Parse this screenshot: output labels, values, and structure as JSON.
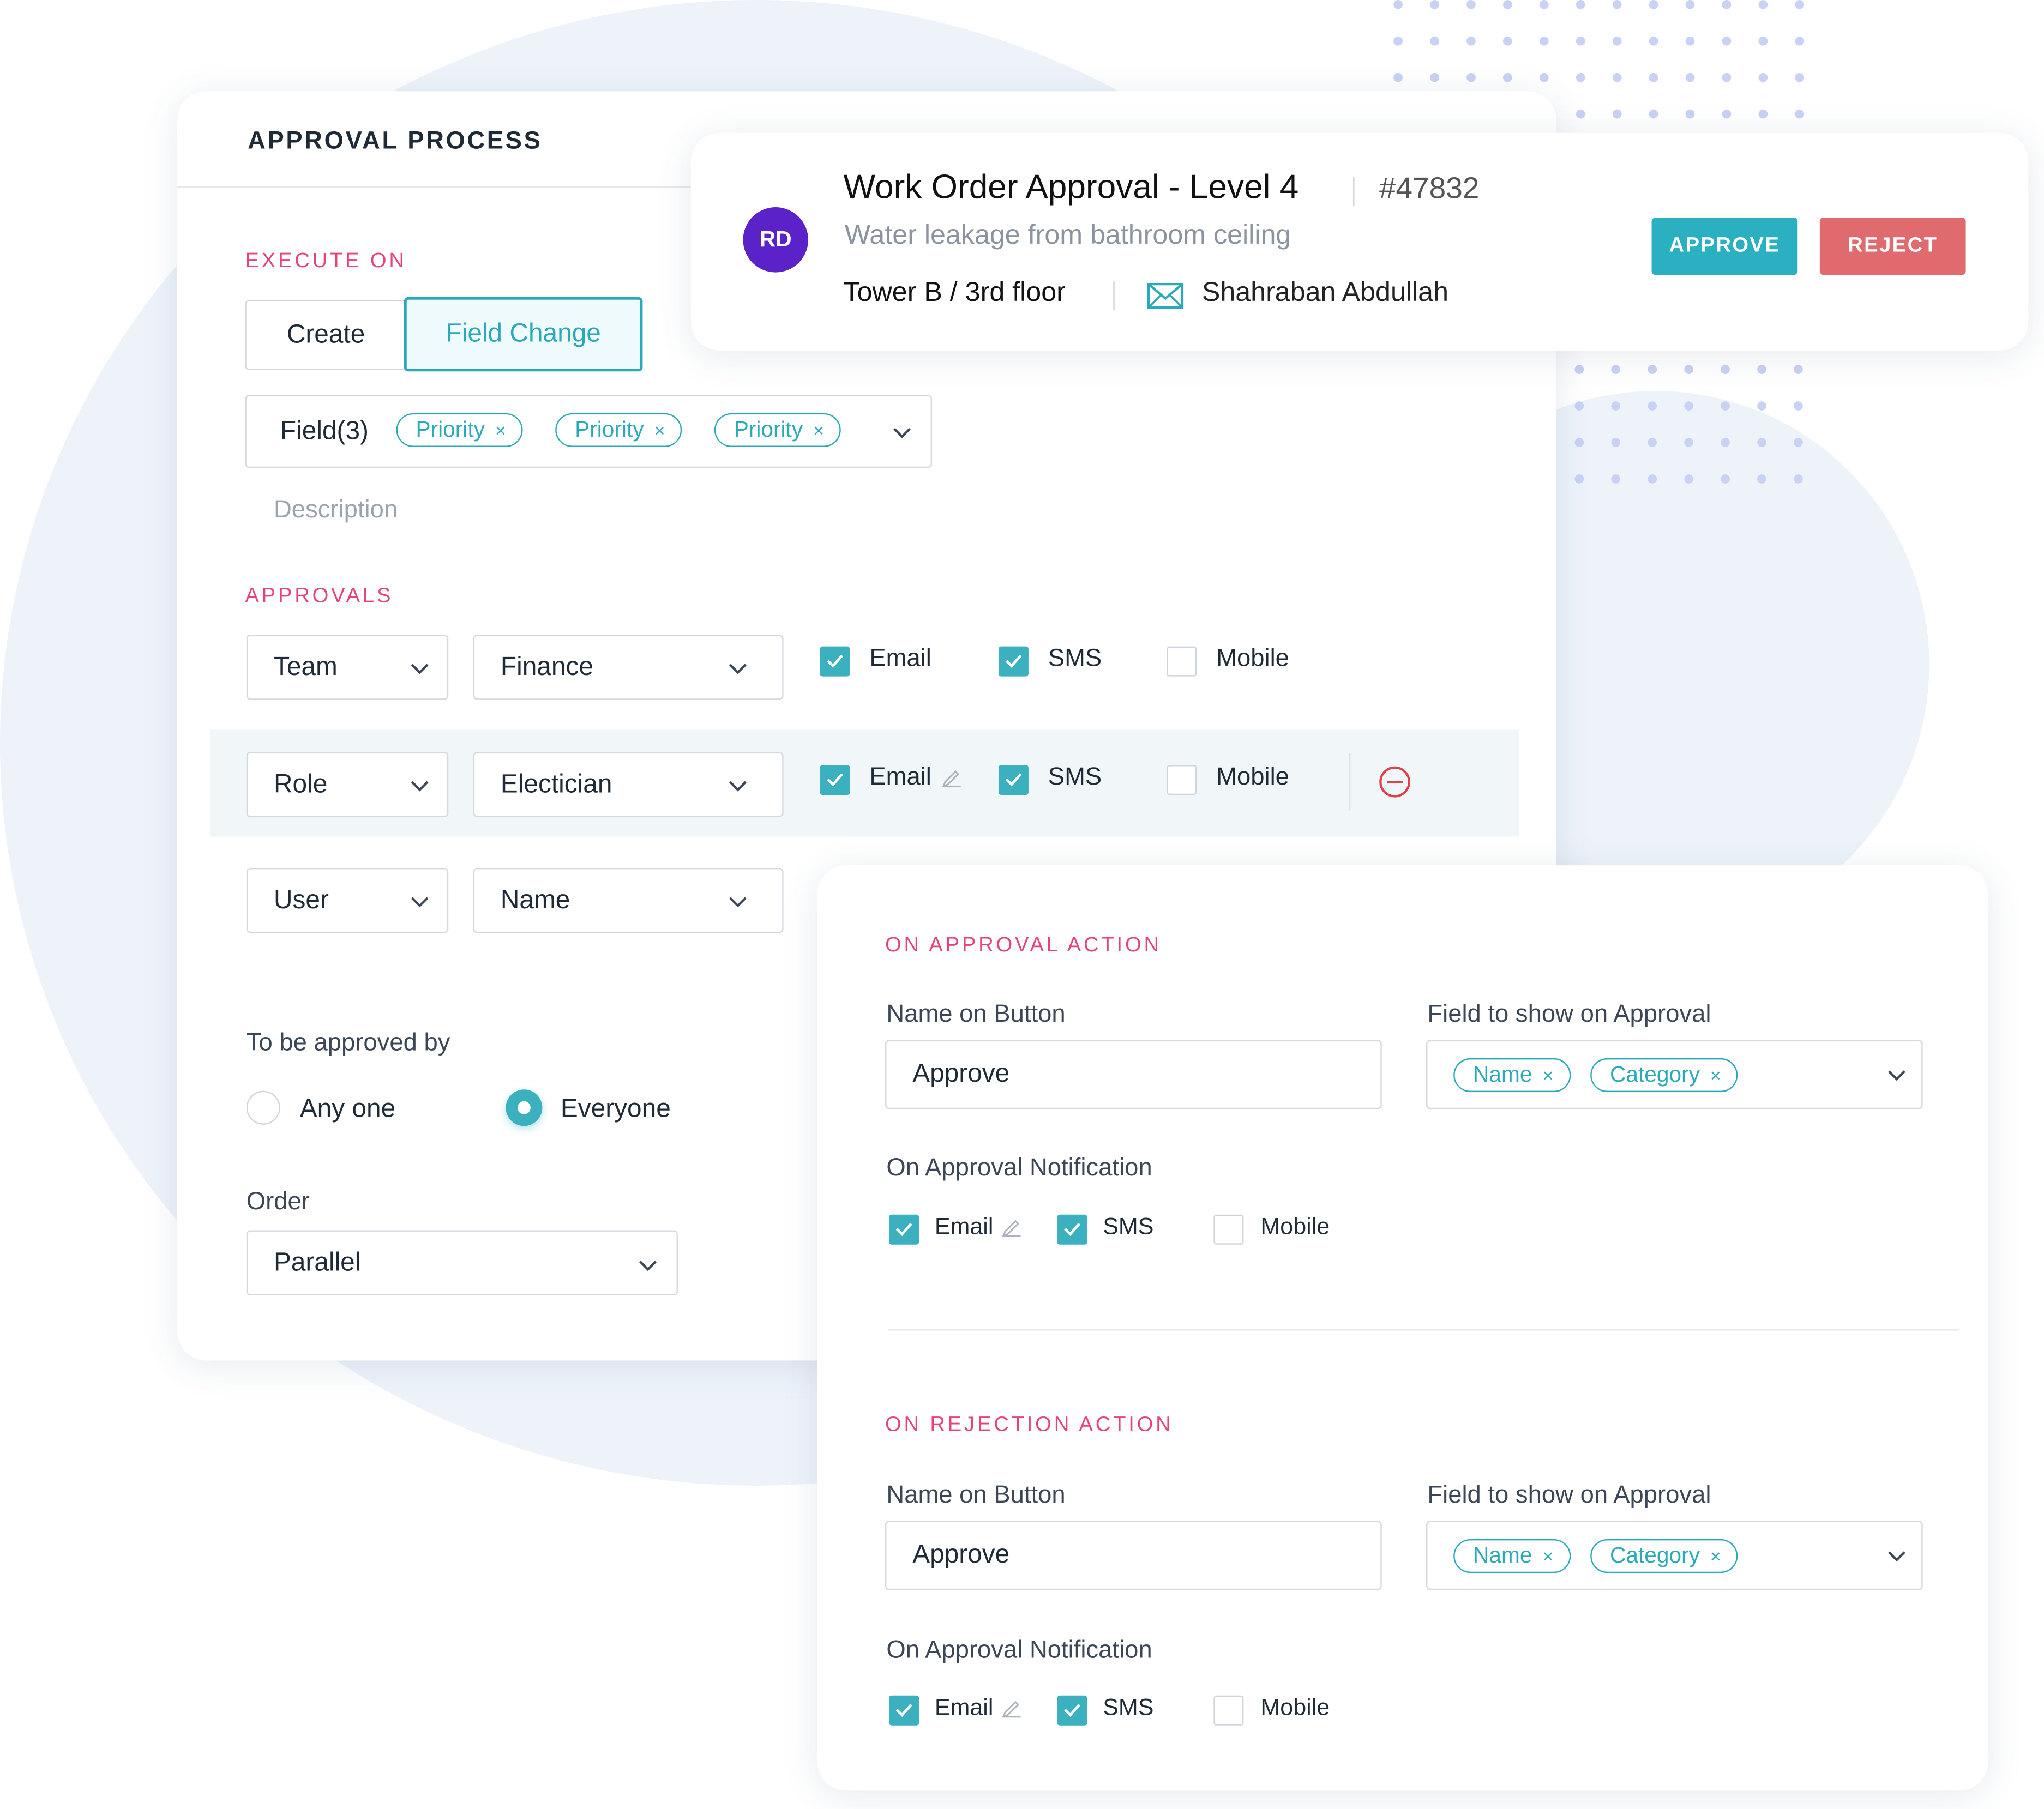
{
  "approval_process": {
    "title": "APPROVAL PROCESS",
    "execute_on": {
      "heading": "EXECUTE ON",
      "options": [
        "Create",
        "Field Change"
      ],
      "selected": "Field Change"
    },
    "fields": {
      "label": "Field(3)",
      "chips": [
        "Priority",
        "Priority",
        "Priority"
      ]
    },
    "description_placeholder": "Description",
    "approvals": {
      "heading": "APPROVALS",
      "rows": [
        {
          "type": "Team",
          "value": "Finance",
          "email": true,
          "sms": true,
          "mobile": false
        },
        {
          "type": "Role",
          "value": "Electician",
          "email": true,
          "sms": true,
          "mobile": false
        },
        {
          "type": "User",
          "value": "Name"
        }
      ],
      "notify_labels": {
        "email": "Email",
        "sms": "SMS",
        "mobile": "Mobile"
      }
    },
    "approved_by": {
      "label": "To be approved by",
      "options": [
        "Any one",
        "Everyone"
      ],
      "selected": "Everyone"
    },
    "order": {
      "label": "Order",
      "value": "Parallel"
    }
  },
  "work_order": {
    "avatar_initials": "RD",
    "avatar_color": "#5b22c9",
    "title": "Work Order Approval - Level 4",
    "id": "#47832",
    "subtitle": "Water leakage from bathroom ceiling",
    "location": "Tower B / 3rd floor",
    "assignee": "Shahraban Abdullah",
    "approve_label": "APPROVE",
    "reject_label": "REJECT",
    "approve_color": "#2bb0c1",
    "reject_color": "#e06b6f"
  },
  "actions": {
    "approval": {
      "heading": "ON APPROVAL ACTION",
      "button_name_label": "Name on Button",
      "button_name_value": "Approve",
      "field_label": "Field to show on Approval",
      "field_chips": [
        "Name",
        "Category"
      ],
      "notification_label": "On Approval Notification",
      "email": true,
      "sms": true,
      "mobile": false
    },
    "rejection": {
      "heading": "ON REJECTION ACTION",
      "button_name_label": "Name on Button",
      "button_name_value": "Approve",
      "field_label": "Field to show on Approval",
      "field_chips": [
        "Name",
        "Category"
      ],
      "notification_label": "On Approval Notification",
      "email": true,
      "sms": true,
      "mobile": false
    },
    "notify_labels": {
      "email": "Email",
      "sms": "SMS",
      "mobile": "Mobile"
    }
  },
  "colors": {
    "accent": "#2aa9b8",
    "section": "#e8427c",
    "check": "#3bb1c0"
  }
}
